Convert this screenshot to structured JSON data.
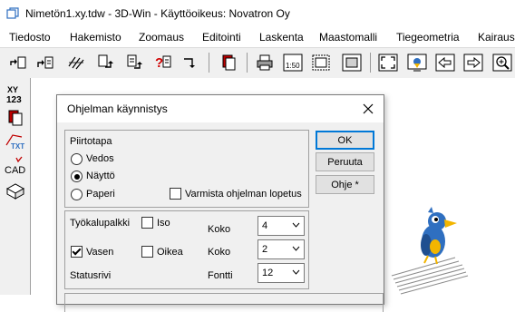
{
  "window": {
    "title": "Nimetön1.xy.tdw - 3D-Win - Käyttöoikeus: Novatron Oy"
  },
  "menu": {
    "items": [
      "Tiedosto",
      "Hakemisto",
      "Zoomaus",
      "Editointi",
      "Laskenta",
      "Maastomalli",
      "Tiegeometria",
      "Kairaus"
    ]
  },
  "toolbar": {
    "icons": [
      "open-icon",
      "open-file-icon",
      "import-icon",
      "save-icon",
      "save-as-icon",
      "help-icon",
      "export-icon",
      "copy-icon",
      "print-icon",
      "scale-icon",
      "area-icon",
      "zoom-extents-icon",
      "view-icon",
      "arrow-left-icon",
      "arrow-right-icon",
      "zoom-in-icon"
    ],
    "scale_label": "1:50"
  },
  "lefttoolbar": {
    "icons": [
      "coordinates-icon",
      "copy-icon",
      "text-icon",
      "cad-icon",
      "box-icon"
    ],
    "coord_label_top": "XY",
    "coord_label_bottom": "123",
    "text_label": "TXT",
    "cad_label": "CAD"
  },
  "dialog": {
    "title": "Ohjelman käynnistys",
    "piirtotapa": {
      "label": "Piirtotapa",
      "options": [
        "Vedos",
        "Näyttö",
        "Paperi"
      ],
      "selected": "Näyttö"
    },
    "varmista_label": "Varmista ohjelman lopetus",
    "varmista_checked": false,
    "buttons": {
      "ok": "OK",
      "peruuta": "Peruuta",
      "ohje": "Ohje *"
    },
    "tyokalupalkki": {
      "label": "Työkalupalkki",
      "iso_label": "Iso",
      "iso_checked": false,
      "vasen_label": "Vasen",
      "vasen_checked": true,
      "oikea_label": "Oikea",
      "oikea_checked": false,
      "statusrivi_label": "Statusrivi",
      "koko1_label": "Koko",
      "koko1_value": "4",
      "koko2_label": "Koko",
      "koko2_value": "2",
      "fontti_label": "Fontti",
      "fontti_value": "12"
    }
  },
  "colors": {
    "mascot_blue": "#2f6fc0",
    "mascot_yellow": "#f2b500"
  }
}
